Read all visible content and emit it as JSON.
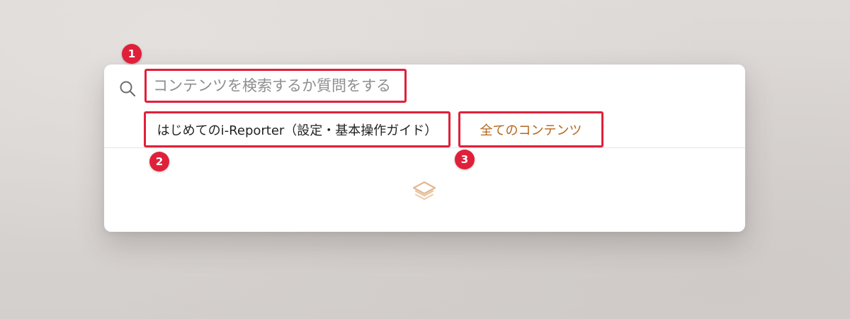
{
  "search": {
    "placeholder": "コンテンツを検索するか質問をする",
    "icon": "search-icon"
  },
  "chips": [
    {
      "label": "はじめてのi-Reporter（設定・基本操作ガイド）",
      "color": "#222222"
    },
    {
      "label": "全てのコンテンツ",
      "color": "#b3651c"
    }
  ],
  "annotations": [
    "1",
    "2",
    "3"
  ],
  "colors": {
    "highlight": "#e0203a",
    "accent": "#b3651c",
    "logo": "#e3b890"
  },
  "footer": {
    "icon": "layers-logo-icon"
  }
}
